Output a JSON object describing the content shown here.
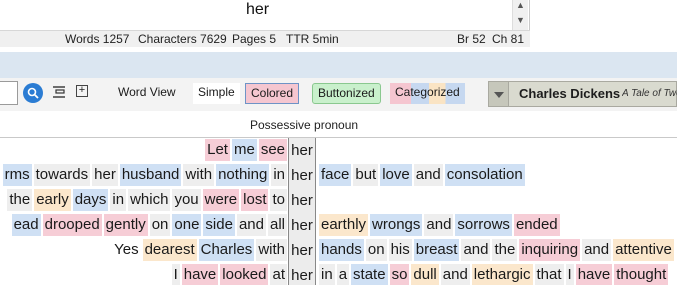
{
  "search": {
    "text": "her"
  },
  "status": {
    "words": "Words 1257",
    "characters": "Characters 7629",
    "pages": "Pages 5",
    "ttr": "TTR 5min",
    "br": "Br 52",
    "ch": "Ch 81"
  },
  "toolbar": {
    "word_view": "Word View",
    "simple": "Simple",
    "colored": "Colored",
    "buttonized": "Buttonized",
    "categorized": "Categorized"
  },
  "book": {
    "author": "Charles Dickens",
    "title": "A Tale of Two Cities"
  },
  "concordance": {
    "header": "Possessive pronoun",
    "rows": [
      {
        "left": [
          [
            "Let",
            "p"
          ],
          [
            "me",
            "b"
          ],
          [
            "see",
            "p"
          ]
        ],
        "keyword": "her",
        "right": []
      },
      {
        "left": [
          [
            "rms",
            "b"
          ],
          [
            "towards",
            "g"
          ],
          [
            "her",
            "g"
          ],
          [
            "husband",
            "b"
          ],
          [
            "with",
            "g"
          ],
          [
            "nothing",
            "b"
          ],
          [
            "in",
            "g"
          ]
        ],
        "keyword": "her",
        "right": [
          [
            "face",
            "b"
          ],
          [
            "but",
            "g"
          ],
          [
            "love",
            "b"
          ],
          [
            "and",
            "g"
          ],
          [
            "consolation",
            "b"
          ]
        ]
      },
      {
        "left": [
          [
            "the",
            "g"
          ],
          [
            "early",
            "o"
          ],
          [
            "days",
            "b"
          ],
          [
            "in",
            "g"
          ],
          [
            "which",
            "g"
          ],
          [
            "you",
            "g"
          ],
          [
            "were",
            "p"
          ],
          [
            "lost",
            "p"
          ],
          [
            "to",
            "g"
          ]
        ],
        "keyword": "her",
        "right": []
      },
      {
        "left": [
          [
            "ead",
            "b"
          ],
          [
            "drooped",
            "p"
          ],
          [
            "gently",
            "p"
          ],
          [
            "on",
            "g"
          ],
          [
            "one",
            "b"
          ],
          [
            "side",
            "b"
          ],
          [
            "and",
            "g"
          ],
          [
            "all",
            "g"
          ]
        ],
        "keyword": "her",
        "right": [
          [
            "earthly",
            "o"
          ],
          [
            "wrongs",
            "b"
          ],
          [
            "and",
            "g"
          ],
          [
            "sorrows",
            "b"
          ],
          [
            "ended",
            "p"
          ]
        ]
      },
      {
        "left": [
          [
            "Yes",
            "n"
          ],
          [
            "dearest",
            "o"
          ],
          [
            "Charles",
            "b"
          ],
          [
            "with",
            "g"
          ]
        ],
        "keyword": "her",
        "right": [
          [
            "hands",
            "b"
          ],
          [
            "on",
            "g"
          ],
          [
            "his",
            "g"
          ],
          [
            "breast",
            "b"
          ],
          [
            "and",
            "g"
          ],
          [
            "the",
            "g"
          ],
          [
            "inquiring",
            "p"
          ],
          [
            "and",
            "g"
          ],
          [
            "attentive",
            "o"
          ]
        ]
      },
      {
        "left": [
          [
            "I",
            "g"
          ],
          [
            "have",
            "p"
          ],
          [
            "looked",
            "p"
          ],
          [
            "at",
            "g"
          ]
        ],
        "keyword": "her",
        "right": [
          [
            "in",
            "g"
          ],
          [
            "a",
            "g"
          ],
          [
            "state",
            "b"
          ],
          [
            "so",
            "p"
          ],
          [
            "dull",
            "o"
          ],
          [
            "and",
            "g"
          ],
          [
            "lethargic",
            "o"
          ],
          [
            "that",
            "g"
          ],
          [
            "I",
            "g"
          ],
          [
            "have",
            "p"
          ],
          [
            "thought",
            "p"
          ]
        ]
      }
    ]
  },
  "colors": {
    "pink": "#f6cdd6",
    "blue": "#cfe0f4",
    "orange": "#fbe7cc",
    "gray": "#eeeeee"
  },
  "icons": {
    "search": "search-icon",
    "filter": "filter-icon",
    "expand": "expand-icon",
    "dropdown": "chevron-down-icon"
  }
}
